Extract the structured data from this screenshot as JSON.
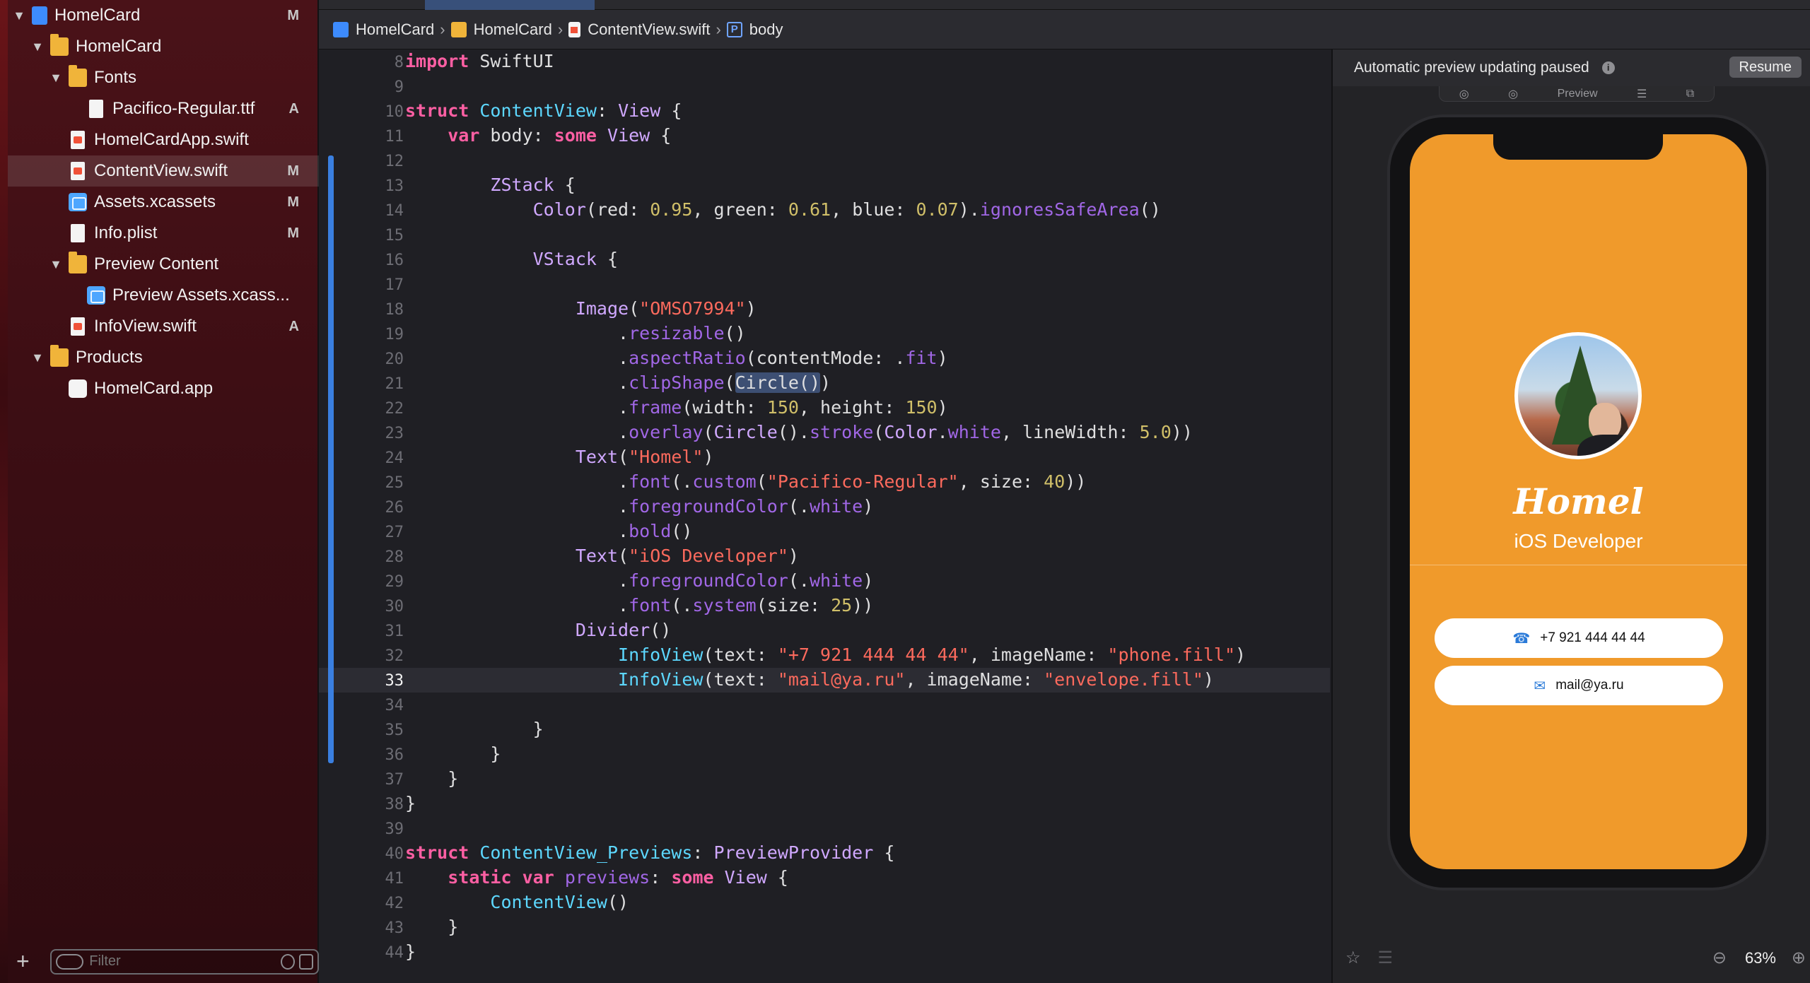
{
  "navigator": {
    "items": [
      {
        "label": "HomelCard",
        "badge": "M",
        "icon": "project-icon",
        "depth": 0,
        "disclosure": "open"
      },
      {
        "label": "HomelCard",
        "badge": "",
        "icon": "folder-icon",
        "depth": 1,
        "disclosure": "open"
      },
      {
        "label": "Fonts",
        "badge": "",
        "icon": "folder-icon",
        "depth": 2,
        "disclosure": "open"
      },
      {
        "label": "Pacifico-Regular.ttf",
        "badge": "A",
        "icon": "file-icon",
        "depth": 3,
        "disclosure": ""
      },
      {
        "label": "HomelCardApp.swift",
        "badge": "",
        "icon": "swift-file-icon",
        "depth": 2,
        "disclosure": ""
      },
      {
        "label": "ContentView.swift",
        "badge": "M",
        "icon": "swift-file-icon",
        "depth": 2,
        "disclosure": "",
        "selected": true
      },
      {
        "label": "Assets.xcassets",
        "badge": "M",
        "icon": "assets-icon",
        "depth": 2,
        "disclosure": ""
      },
      {
        "label": "Info.plist",
        "badge": "M",
        "icon": "file-icon",
        "depth": 2,
        "disclosure": ""
      },
      {
        "label": "Preview Content",
        "badge": "",
        "icon": "folder-icon",
        "depth": 2,
        "disclosure": "open"
      },
      {
        "label": "Preview Assets.xcass...",
        "badge": "",
        "icon": "assets-icon",
        "depth": 3,
        "disclosure": ""
      },
      {
        "label": "InfoView.swift",
        "badge": "A",
        "icon": "swift-file-icon",
        "depth": 2,
        "disclosure": ""
      },
      {
        "label": "Products",
        "badge": "",
        "icon": "folder-icon",
        "depth": 1,
        "disclosure": "open"
      },
      {
        "label": "HomelCard.app",
        "badge": "",
        "icon": "app-icon",
        "depth": 2,
        "disclosure": ""
      }
    ],
    "filter_placeholder": "Filter",
    "add_symbol": "+"
  },
  "jumpbar": {
    "crumbs": [
      {
        "label": "HomelCard",
        "icon": "project-icon"
      },
      {
        "label": "HomelCard",
        "icon": "folder-icon"
      },
      {
        "label": "ContentView.swift",
        "icon": "swift-file-icon"
      },
      {
        "label": "body",
        "icon": "property-icon",
        "glyph": "P"
      }
    ]
  },
  "editor": {
    "current_line": 33,
    "lines": [
      {
        "n": 8,
        "code": [
          [
            "k",
            "import"
          ],
          [
            "p",
            " SwiftUI"
          ]
        ]
      },
      {
        "n": 9,
        "code": []
      },
      {
        "n": 10,
        "code": [
          [
            "k",
            "struct"
          ],
          [
            "p",
            " "
          ],
          [
            "t",
            "ContentView"
          ],
          [
            "p",
            ": "
          ],
          [
            "ty",
            "View"
          ],
          [
            "p",
            " {"
          ]
        ]
      },
      {
        "n": 11,
        "code": [
          [
            "p",
            "    "
          ],
          [
            "k",
            "var"
          ],
          [
            "p",
            " body: "
          ],
          [
            "k",
            "some"
          ],
          [
            "p",
            " "
          ],
          [
            "ty",
            "View"
          ],
          [
            "p",
            " {"
          ]
        ]
      },
      {
        "n": 12,
        "code": []
      },
      {
        "n": 13,
        "code": [
          [
            "p",
            "        "
          ],
          [
            "ty",
            "ZStack"
          ],
          [
            "p",
            " {"
          ]
        ]
      },
      {
        "n": 14,
        "code": [
          [
            "p",
            "            "
          ],
          [
            "ty",
            "Color"
          ],
          [
            "p",
            "(red: "
          ],
          [
            "n",
            "0.95"
          ],
          [
            "p",
            ", green: "
          ],
          [
            "n",
            "0.61"
          ],
          [
            "p",
            ", blue: "
          ],
          [
            "n",
            "0.07"
          ],
          [
            "p",
            ")."
          ],
          [
            "m",
            "ignoresSafeArea"
          ],
          [
            "p",
            "()"
          ]
        ]
      },
      {
        "n": 15,
        "code": []
      },
      {
        "n": 16,
        "code": [
          [
            "p",
            "            "
          ],
          [
            "ty",
            "VStack"
          ],
          [
            "p",
            " {"
          ]
        ]
      },
      {
        "n": 17,
        "code": []
      },
      {
        "n": 18,
        "code": [
          [
            "p",
            "                "
          ],
          [
            "ty",
            "Image"
          ],
          [
            "p",
            "("
          ],
          [
            "s",
            "\"OMSO7994\""
          ],
          [
            "p",
            ")"
          ]
        ]
      },
      {
        "n": 19,
        "code": [
          [
            "p",
            "                    ."
          ],
          [
            "m",
            "resizable"
          ],
          [
            "p",
            "()"
          ]
        ]
      },
      {
        "n": 20,
        "code": [
          [
            "p",
            "                    ."
          ],
          [
            "m",
            "aspectRatio"
          ],
          [
            "p",
            "(contentMode: ."
          ],
          [
            "m",
            "fit"
          ],
          [
            "p",
            ")"
          ]
        ]
      },
      {
        "n": 21,
        "code": [
          [
            "p",
            "                    ."
          ],
          [
            "m",
            "clipShape"
          ],
          [
            "p",
            "("
          ],
          [
            "hl",
            "Circle()"
          ],
          [
            "p",
            ")"
          ]
        ]
      },
      {
        "n": 22,
        "code": [
          [
            "p",
            "                    ."
          ],
          [
            "m",
            "frame"
          ],
          [
            "p",
            "(width: "
          ],
          [
            "n",
            "150"
          ],
          [
            "p",
            ", height: "
          ],
          [
            "n",
            "150"
          ],
          [
            "p",
            ")"
          ]
        ]
      },
      {
        "n": 23,
        "code": [
          [
            "p",
            "                    ."
          ],
          [
            "m",
            "overlay"
          ],
          [
            "p",
            "("
          ],
          [
            "ty",
            "Circle"
          ],
          [
            "p",
            "()."
          ],
          [
            "m",
            "stroke"
          ],
          [
            "p",
            "("
          ],
          [
            "ty",
            "Color"
          ],
          [
            "p",
            "."
          ],
          [
            "m",
            "white"
          ],
          [
            "p",
            ", lineWidth: "
          ],
          [
            "n",
            "5.0"
          ],
          [
            "p",
            "))"
          ]
        ]
      },
      {
        "n": 24,
        "code": [
          [
            "p",
            "                "
          ],
          [
            "ty",
            "Text"
          ],
          [
            "p",
            "("
          ],
          [
            "s",
            "\"Homel\""
          ],
          [
            "p",
            ")"
          ]
        ]
      },
      {
        "n": 25,
        "code": [
          [
            "p",
            "                    ."
          ],
          [
            "m",
            "font"
          ],
          [
            "p",
            "(."
          ],
          [
            "m",
            "custom"
          ],
          [
            "p",
            "("
          ],
          [
            "s",
            "\"Pacifico-Regular\""
          ],
          [
            "p",
            ", size: "
          ],
          [
            "n",
            "40"
          ],
          [
            "p",
            "))"
          ]
        ]
      },
      {
        "n": 26,
        "code": [
          [
            "p",
            "                    ."
          ],
          [
            "m",
            "foregroundColor"
          ],
          [
            "p",
            "(."
          ],
          [
            "m",
            "white"
          ],
          [
            "p",
            ")"
          ]
        ]
      },
      {
        "n": 27,
        "code": [
          [
            "p",
            "                    ."
          ],
          [
            "m",
            "bold"
          ],
          [
            "p",
            "()"
          ]
        ]
      },
      {
        "n": 28,
        "code": [
          [
            "p",
            "                "
          ],
          [
            "ty",
            "Text"
          ],
          [
            "p",
            "("
          ],
          [
            "s",
            "\"iOS Developer\""
          ],
          [
            "p",
            ")"
          ]
        ]
      },
      {
        "n": 29,
        "code": [
          [
            "p",
            "                    ."
          ],
          [
            "m",
            "foregroundColor"
          ],
          [
            "p",
            "(."
          ],
          [
            "m",
            "white"
          ],
          [
            "p",
            ")"
          ]
        ]
      },
      {
        "n": 30,
        "code": [
          [
            "p",
            "                    ."
          ],
          [
            "m",
            "font"
          ],
          [
            "p",
            "(."
          ],
          [
            "m",
            "system"
          ],
          [
            "p",
            "(size: "
          ],
          [
            "n",
            "25"
          ],
          [
            "p",
            "))"
          ]
        ]
      },
      {
        "n": 31,
        "code": [
          [
            "p",
            "                "
          ],
          [
            "ty",
            "Divider"
          ],
          [
            "p",
            "()"
          ]
        ]
      },
      {
        "n": 32,
        "code": [
          [
            "p",
            "                    "
          ],
          [
            "t",
            "InfoView"
          ],
          [
            "p",
            "(text: "
          ],
          [
            "s",
            "\"+7 921 444 44 44\""
          ],
          [
            "p",
            ", imageName: "
          ],
          [
            "s",
            "\"phone.fill\""
          ],
          [
            "p",
            ")"
          ]
        ]
      },
      {
        "n": 33,
        "code": [
          [
            "p",
            "                    "
          ],
          [
            "t",
            "InfoView"
          ],
          [
            "p",
            "(text: "
          ],
          [
            "s",
            "\"mail@ya.ru\""
          ],
          [
            "p",
            ", imageName: "
          ],
          [
            "s",
            "\"envelope.fill\""
          ],
          [
            "p",
            ")"
          ]
        ]
      },
      {
        "n": 34,
        "code": []
      },
      {
        "n": 35,
        "code": [
          [
            "p",
            "            }"
          ]
        ]
      },
      {
        "n": 36,
        "code": [
          [
            "p",
            "        }"
          ]
        ]
      },
      {
        "n": 37,
        "code": [
          [
            "p",
            "    }"
          ]
        ]
      },
      {
        "n": 38,
        "code": [
          [
            "p",
            "}"
          ]
        ]
      },
      {
        "n": 39,
        "code": []
      },
      {
        "n": 40,
        "code": [
          [
            "k",
            "struct"
          ],
          [
            "p",
            " "
          ],
          [
            "t",
            "ContentView_Previews"
          ],
          [
            "p",
            ": "
          ],
          [
            "ty",
            "PreviewProvider"
          ],
          [
            "p",
            " {"
          ]
        ]
      },
      {
        "n": 41,
        "code": [
          [
            "p",
            "    "
          ],
          [
            "k",
            "static"
          ],
          [
            "p",
            " "
          ],
          [
            "k",
            "var"
          ],
          [
            "p",
            " "
          ],
          [
            "m",
            "previews"
          ],
          [
            "p",
            ": "
          ],
          [
            "k",
            "some"
          ],
          [
            "p",
            " "
          ],
          [
            "ty",
            "View"
          ],
          [
            "p",
            " {"
          ]
        ]
      },
      {
        "n": 42,
        "code": [
          [
            "p",
            "        "
          ],
          [
            "t",
            "ContentView"
          ],
          [
            "p",
            "()"
          ]
        ]
      },
      {
        "n": 43,
        "code": [
          [
            "p",
            "    }"
          ]
        ]
      },
      {
        "n": 44,
        "code": [
          [
            "p",
            "}"
          ]
        ]
      }
    ]
  },
  "canvas": {
    "status": "Automatic preview updating paused",
    "info_glyph": "i",
    "resume_label": "Resume",
    "preview_tab": "Preview",
    "zoom_level": "63%",
    "screen_color": "#f09a2b",
    "card": {
      "name": "Homel",
      "role": "iOS Developer",
      "rows": [
        {
          "text": "+7 921 444 44 44",
          "icon": "phone-icon",
          "glyph": "☎"
        },
        {
          "text": "mail@ya.ru",
          "icon": "envelope-icon",
          "glyph": "✉"
        }
      ]
    }
  }
}
